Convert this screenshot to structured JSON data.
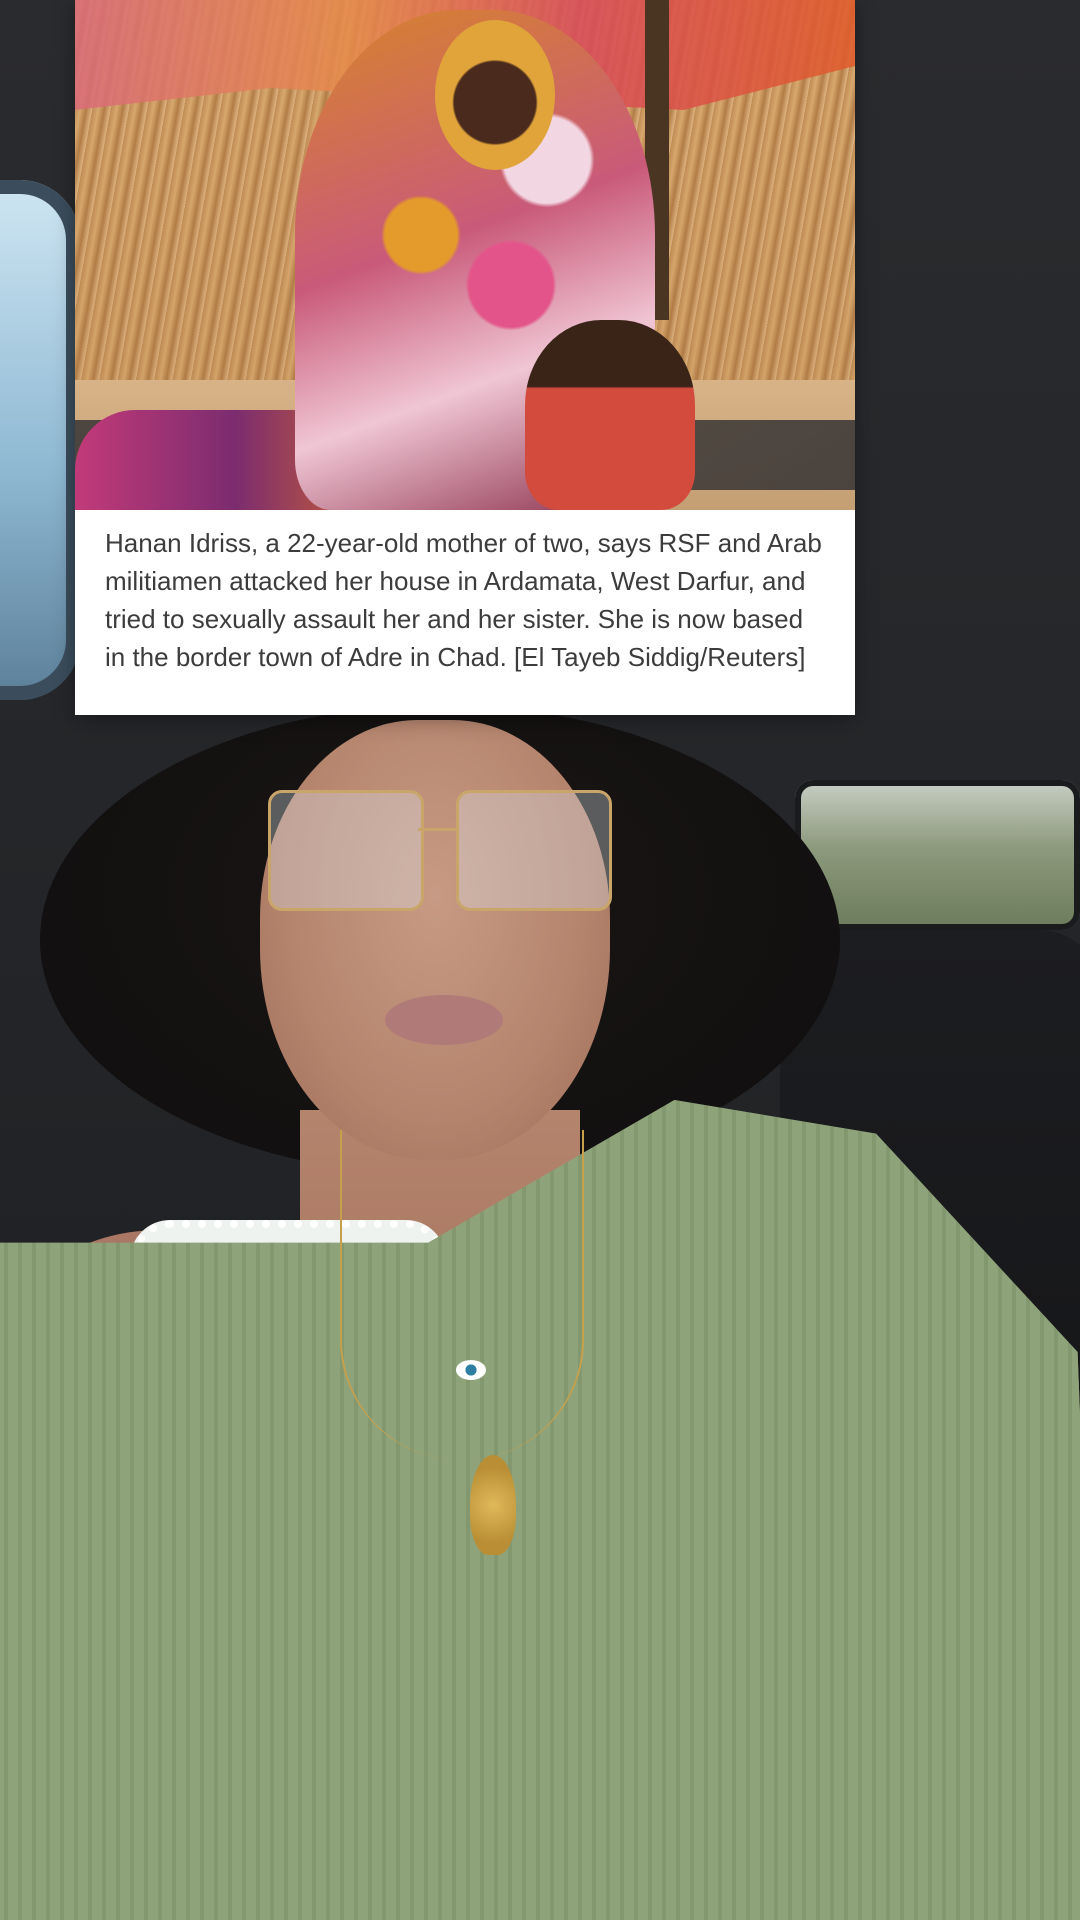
{
  "news_card": {
    "caption": "Hanan Idriss, a 22-year-old mother of two, says RSF and Arab militiamen attacked her house in Ardamata, West Darfur, and tried to sexually assault her and her sister. She is now based in the border town of Adre in Chad. [El Tayeb Siddig/Reuters]"
  },
  "colors": {
    "card_background": "#ffffff",
    "caption_text": "#3c3c3c",
    "sweater": "#8a9e76"
  }
}
